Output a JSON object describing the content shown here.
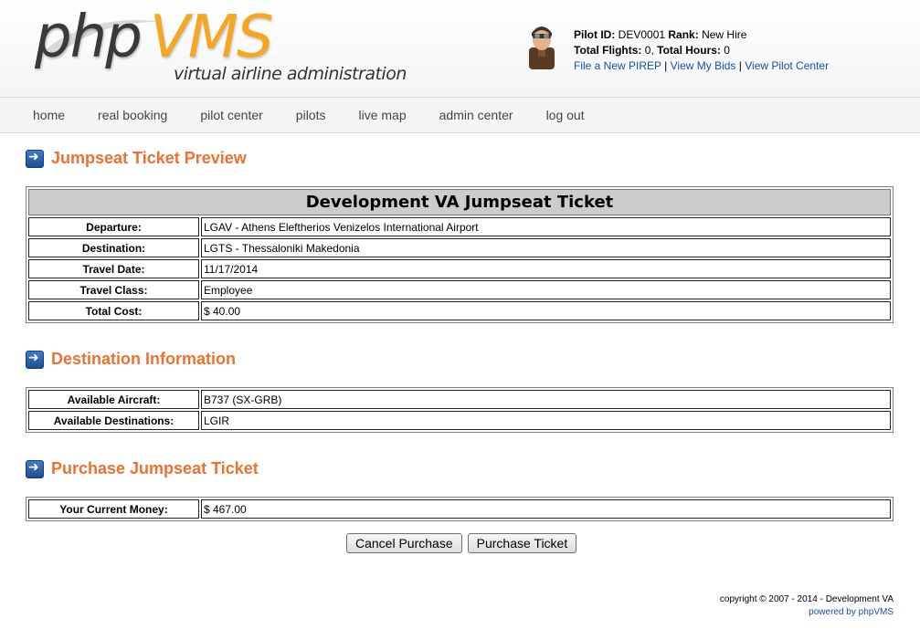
{
  "brand": {
    "logo_part1": "php",
    "logo_part2": "VMS",
    "tagline": "virtual airline administration",
    "accent_color": "#f5a623"
  },
  "pilot": {
    "pilot_id_label": "Pilot ID:",
    "pilot_id": "DEV0001",
    "rank_label": "Rank:",
    "rank": "New Hire",
    "flights_label": "Total Flights:",
    "flights": "0,",
    "hours_label": "Total Hours:",
    "hours": "0",
    "links": [
      "File a New PIREP",
      "View My Bids",
      "View Pilot Center"
    ],
    "separator": "|"
  },
  "nav": {
    "items": [
      "home",
      "real booking",
      "pilot center",
      "pilots",
      "live map",
      "admin center",
      "log out"
    ]
  },
  "sections": {
    "preview_title": "Jumpseat Ticket Preview",
    "destination_title": "Destination Information",
    "purchase_title": "Purchase Jumpseat Ticket",
    "title_color": "#f07030"
  },
  "ticket": {
    "header": "Development VA Jumpseat Ticket",
    "rows": [
      {
        "label": "Departure:",
        "value": "LGAV - Athens Eleftherios Venizelos International Airport"
      },
      {
        "label": "Destination:",
        "value": "LGTS - Thessaloniki Makedonia"
      },
      {
        "label": "Travel Date:",
        "value": "11/17/2014"
      },
      {
        "label": "Travel Class:",
        "value": "Employee"
      },
      {
        "label": "Total Cost:",
        "value": "$ 40.00"
      }
    ]
  },
  "destination": {
    "rows": [
      {
        "label": "Available Aircraft:",
        "value": "B737 (SX-GRB)"
      },
      {
        "label": "Available Destinations:",
        "value": "LGIR"
      }
    ]
  },
  "purchase": {
    "rows": [
      {
        "label": "Your Current Money:",
        "value": "$ 467.00"
      }
    ],
    "cancel_label": "Cancel Purchase",
    "purchase_label": "Purchase Ticket"
  },
  "footer": {
    "copyright": "copyright © 2007 - 2014 - Development VA",
    "powered": "powered by phpVMS"
  }
}
